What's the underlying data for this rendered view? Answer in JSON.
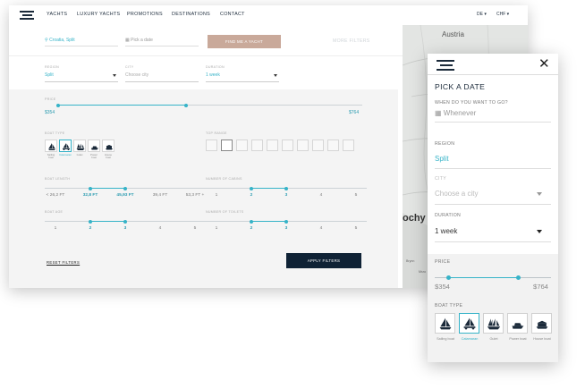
{
  "nav": {
    "items": [
      "YACHTS",
      "LUXURY YACHTS",
      "PROMOTIONS",
      "DESTINATIONS",
      "CONTACT"
    ],
    "language": "DE",
    "currency": "CHF"
  },
  "search": {
    "location": "Croatia, Split",
    "date_placeholder": "Pick a date",
    "find_button": "FIND ME A YACHT",
    "more_filters": "MORE FILTERS"
  },
  "filters": {
    "region_label": "REGION",
    "region_value": "Split",
    "city_label": "CITY",
    "city_placeholder": "Choose city",
    "duration_label": "DURATION",
    "duration_value": "1 week",
    "price_label": "PRICE",
    "price_min": "$354",
    "price_max": "$764",
    "price_range_fraction": [
      0.0,
      0.42
    ],
    "boat_type_label": "BOAT TYPE",
    "boat_types": [
      "Sailing boat",
      "Catamaran",
      "Gulet",
      "Power boat",
      "House boat"
    ],
    "boat_type_selected": "Catamaran",
    "tonnage_label": "TOP RANGE",
    "tonnage_count": 10,
    "tonnage_selected_index": 1,
    "boat_length_label": "BOAT LENGTH",
    "boat_length_ticks": [
      "< 26,2 FT",
      "32,8 FT",
      "45,93 FT",
      "39,4 FT",
      "53,3 FT +"
    ],
    "boat_length_selected": [
      1,
      2
    ],
    "cabins_label": "NUMBER OF CABINS",
    "cabins_ticks": [
      "1",
      "2",
      "3",
      "4",
      "5"
    ],
    "cabins_selected": [
      1,
      2
    ],
    "boat_age_label": "BOAT AGE",
    "boat_age_ticks": [
      "1",
      "2",
      "3",
      "4",
      "5"
    ],
    "boat_age_selected": [
      1,
      2
    ],
    "toilets_label": "NUMBER OF TOILETS",
    "toilets_ticks": [
      "1",
      "2",
      "3",
      "4",
      "5"
    ],
    "toilets_selected": [
      1,
      2
    ],
    "reset_label": "RESET FILTERS",
    "apply_label": "APPLY FILTERS"
  },
  "map": {
    "labels": [
      "Austria",
      "ochy"
    ],
    "small_labels": [
      "Brynn",
      "Mrzo"
    ]
  },
  "mobile": {
    "title": "PICK A DATE",
    "destination_label": "WHEN DO YOU WANT TO GO?",
    "date_placeholder": "Whenever",
    "region_label": "REGION",
    "region_value": "Split",
    "city_label": "CITY",
    "city_placeholder": "Choose a city",
    "duration_label": "DURATION",
    "duration_value": "1 week",
    "price_label": "PRICE",
    "price_min": "$354",
    "price_max": "$764",
    "price_range_fraction": [
      0.12,
      0.72
    ],
    "boat_type_label": "BOAT TYPE",
    "boat_types": [
      "Sailing boat",
      "Catamaran",
      "Gulet",
      "Power boat",
      "House boat"
    ],
    "boat_type_selected": "Catamaran"
  },
  "colors": {
    "accent": "#36b3c8",
    "navy": "#0f2235",
    "find_button": "#c9a99a",
    "panel_bg": "#f4f4f4"
  }
}
